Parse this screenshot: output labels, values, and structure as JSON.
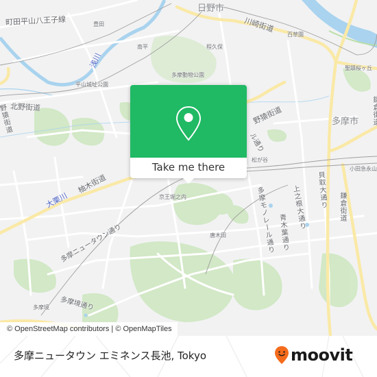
{
  "map": {
    "place_labels": [
      {
        "id": "hino-city",
        "text": "日野市",
        "kind": "big"
      },
      {
        "id": "tama-city",
        "text": "多摩市",
        "kind": "big"
      },
      {
        "id": "toyoda",
        "text": "豊田",
        "kind": "small"
      },
      {
        "id": "minamidaira",
        "text": "南平",
        "kind": "small"
      },
      {
        "id": "hodokubo",
        "text": "程久保",
        "kind": "small"
      },
      {
        "id": "mogusaen",
        "text": "百草園",
        "kind": "small"
      },
      {
        "id": "seiseki-sakuragaoka",
        "text": "聖蹟桜ヶ丘",
        "kind": "small"
      },
      {
        "id": "hirayama-joshi-koen",
        "text": "平山城址公園",
        "kind": "small"
      },
      {
        "id": "tama-dobutsu-koen",
        "text": "多摩動物公園",
        "kind": "small"
      },
      {
        "id": "matsugaya",
        "text": "松が谷",
        "kind": "small"
      },
      {
        "id": "odakyu-nagayama",
        "text": "小田急永山",
        "kind": "small"
      },
      {
        "id": "keio-horinouchi",
        "text": "京王堀之内",
        "kind": "small"
      },
      {
        "id": "karakida",
        "text": "唐木田",
        "kind": "small"
      },
      {
        "id": "tamasakai",
        "text": "多摩境",
        "kind": "small"
      }
    ],
    "road_labels": [
      {
        "id": "machida-hirayama-hachioji-line",
        "text": "町田平山八王子線"
      },
      {
        "id": "kawasaki-kaido",
        "text": "川崎街道"
      },
      {
        "id": "kitano-kaido",
        "text": "北野街道"
      },
      {
        "id": "nozaru-kaido",
        "text": "野猿街道"
      },
      {
        "id": "yuki-kaido",
        "text": "柚木街道"
      },
      {
        "id": "tama-newtown-dori",
        "text": "多摩ニュータウン通り"
      },
      {
        "id": "tamasakai-dori",
        "text": "多摩境通り"
      },
      {
        "id": "tama-monorail-dori",
        "text": "多摩モノレール通り"
      },
      {
        "id": "aokiba-dori",
        "text": "青木葉通り"
      },
      {
        "id": "kaminone-odori",
        "text": "上之根大通り"
      },
      {
        "id": "kaitori-odori",
        "text": "貝取大通り"
      },
      {
        "id": "kamakura-kaido",
        "text": "鎌倉街道"
      },
      {
        "id": "monorail-dori-partial",
        "text": "ル通り"
      },
      {
        "id": "left-kaido-partial",
        "text": "野猿街道"
      }
    ],
    "river_labels": [
      {
        "id": "asakawa",
        "text": "浅川"
      },
      {
        "id": "ookurigawa",
        "text": "大栗川"
      }
    ],
    "popup": {
      "icon": "map-pin-icon",
      "cta_label": "Take me there",
      "color": "#20b964"
    },
    "attribution": "© OpenStreetMap contributors | © OpenMapTiles"
  },
  "footer": {
    "title": "多摩ニュータウン エミネンス長池, Tokyo",
    "logo_text": "moovit",
    "logo_icon": "moovit-pin-smile-icon",
    "logo_color": "#f46b1c"
  }
}
